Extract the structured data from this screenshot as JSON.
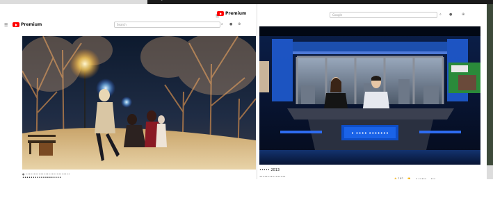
{
  "top_strip": {
    "text": "▸ • • • •"
  },
  "left_window": {
    "brand": "Premium",
    "search_placeholder": "Search",
    "video": {
      "meta": "● •••••••••••••••••••••••••••",
      "title": "•••••••••••••••••••"
    }
  },
  "right_window": {
    "brand": "Premium",
    "search_placeholder": "Google",
    "video": {
      "title": "••••• 2013",
      "meta": "••••••••••••••••",
      "news_logo": "• •••• •••••••",
      "actions": [
        "👍 195",
        "👎",
        "↗ •••••",
        "•••"
      ]
    }
  }
}
